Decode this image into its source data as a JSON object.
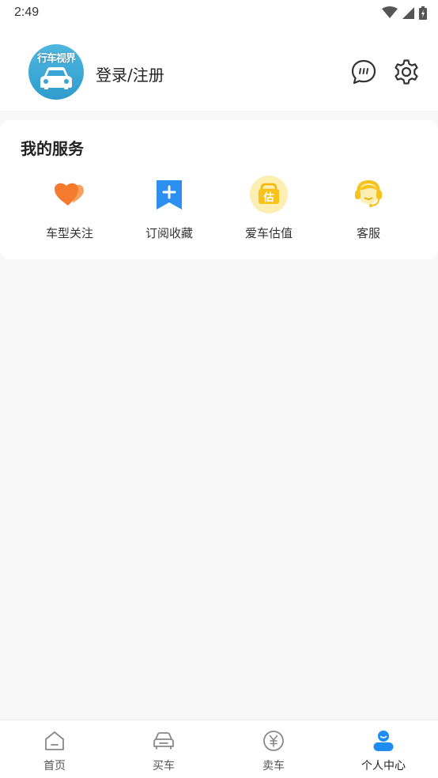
{
  "status_bar": {
    "time": "2:49"
  },
  "profile": {
    "avatar_text": "行车视界",
    "login_label": "登录/注册",
    "message_icon": "chat-bubble-icon",
    "settings_icon": "gear-icon"
  },
  "services": {
    "title": "我的服务",
    "items": [
      {
        "label": "车型关注",
        "icon": "heart-icon",
        "color": "#f47a2e"
      },
      {
        "label": "订阅收藏",
        "icon": "bookmark-plus-icon",
        "color": "#2d8ff0"
      },
      {
        "label": "爱车估值",
        "icon": "valuation-icon",
        "icon_text": "估",
        "color": "#f7c21c"
      },
      {
        "label": "客服",
        "icon": "headset-icon",
        "color": "#f7c21c"
      }
    ]
  },
  "bottom_nav": {
    "items": [
      {
        "label": "首页",
        "icon": "home-icon",
        "active": false
      },
      {
        "label": "买车",
        "icon": "car-icon",
        "active": false
      },
      {
        "label": "卖车",
        "icon": "yen-coin-icon",
        "active": false
      },
      {
        "label": "个人中心",
        "icon": "person-icon",
        "active": true
      }
    ],
    "active_color": "#1e8cf0",
    "inactive_color": "#888888"
  }
}
